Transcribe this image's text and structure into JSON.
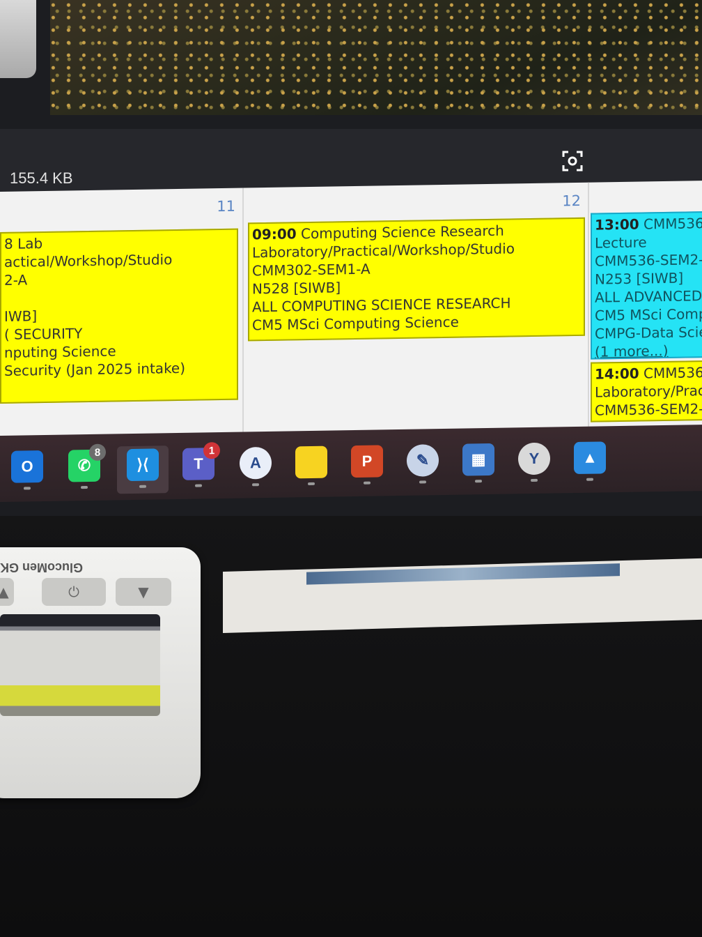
{
  "viewer": {
    "file_size": "155.4 KB",
    "fullscreen_icon": "fullscreen-icon"
  },
  "calendar": {
    "days": [
      {
        "number": "11",
        "events": [
          {
            "color": "#ffff00",
            "lines": [
              "8 Lab",
              "actical/Workshop/Studio",
              "2-A",
              "",
              "IWB]",
              "( SECURITY",
              "nputing Science",
              "Security (Jan 2025 intake)"
            ]
          }
        ]
      },
      {
        "number": "12",
        "events": [
          {
            "color": "#ffff00",
            "time": "09:00",
            "title": "Computing Science Research",
            "lines": [
              "Laboratory/Practical/Workshop/Studio",
              "CMM302-SEM1-A",
              "N528 [SIWB]",
              "ALL COMPUTING SCIENCE RESEARCH",
              "CM5 MSci Computing Science"
            ]
          }
        ]
      },
      {
        "number": "",
        "events": [
          {
            "color": "#25e3f5",
            "time": "13:00",
            "title": "CMM536",
            "lines": [
              "Lecture",
              "CMM536-SEM2-",
              "N253 [SIWB]",
              "ALL ADVANCED",
              "CM5 MSci Comp",
              "CMPG-Data Scie"
            ],
            "more": "(1 more...)"
          },
          {
            "color": "#ffff00",
            "time": "14:00",
            "title": "CMM536",
            "lines": [
              "Laboratory/Prac",
              "CMM536-SEM2-"
            ]
          }
        ]
      }
    ]
  },
  "taskbar": {
    "apps": [
      {
        "name": "outlook-icon",
        "label": "O",
        "color": "#1a73d9"
      },
      {
        "name": "whatsapp-icon",
        "label": "✆",
        "color": "#25d366",
        "badge": "8",
        "badge_color": "#6d6d6d"
      },
      {
        "name": "vscode-icon",
        "label": "⟩⟨",
        "color": "#1e8fe0"
      },
      {
        "name": "teams-icon",
        "label": "T",
        "color": "#5b5fc7",
        "badge": "1",
        "badge_color": "#d13438"
      },
      {
        "name": "app-store-icon",
        "label": "A",
        "color": "#e9eef8"
      },
      {
        "name": "sticky-notes-icon",
        "label": "",
        "color": "#f7d321"
      },
      {
        "name": "powerpoint-icon",
        "label": "P",
        "color": "#d24726"
      },
      {
        "name": "snipping-tool-icon",
        "label": "✎",
        "color": "#c8d4e8"
      },
      {
        "name": "calculator-icon",
        "label": "▦",
        "color": "#3c78c8"
      },
      {
        "name": "clock-icon",
        "label": "Y",
        "color": "#d9d9d9"
      },
      {
        "name": "photos-icon",
        "label": "▲",
        "color": "#2b8be0"
      }
    ]
  },
  "desk": {
    "card_text": "",
    "meter_brand": "GlucoMen GK",
    "meter_power_symbol": "⏻"
  }
}
